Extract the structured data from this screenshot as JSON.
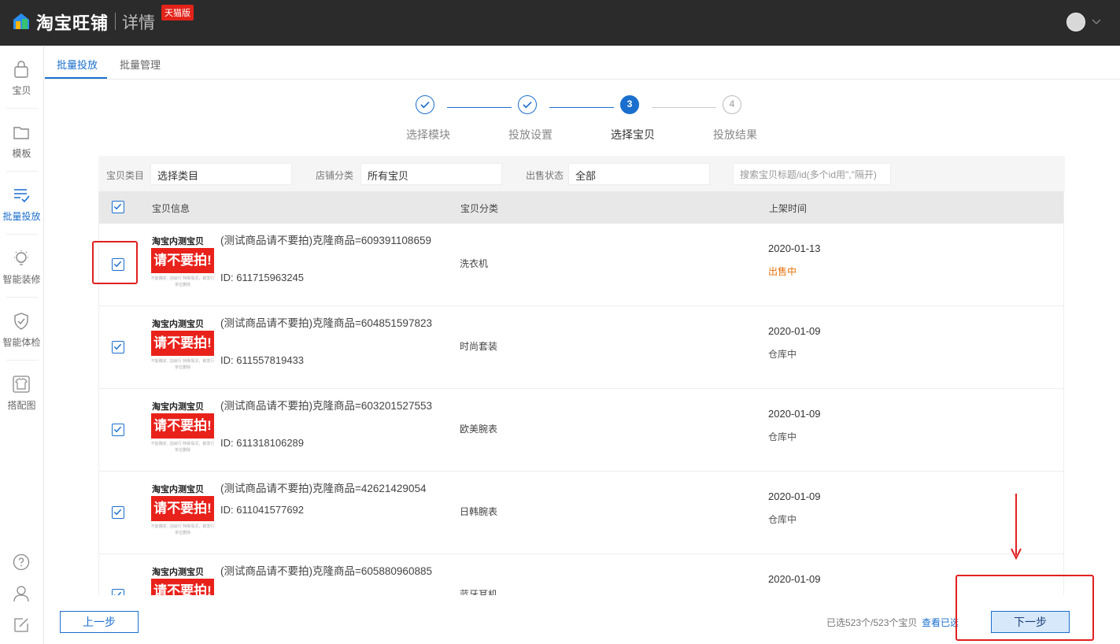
{
  "header": {
    "brand": "淘宝旺铺",
    "sub": "详情",
    "badge": "天猫版"
  },
  "sidebar": {
    "items": [
      {
        "label": "宝贝",
        "icon": "bag-icon"
      },
      {
        "label": "模板",
        "icon": "folder-icon"
      },
      {
        "label": "批量投放",
        "icon": "batch-list-icon"
      },
      {
        "label": "智能装修",
        "icon": "bulb-icon"
      },
      {
        "label": "智能体检",
        "icon": "shield-check-icon"
      },
      {
        "label": "搭配图",
        "icon": "shirt-icon"
      }
    ],
    "bottom_icons": [
      "help-icon",
      "user-icon",
      "edit-icon"
    ]
  },
  "tabs": [
    {
      "label": "批量投放",
      "active": true
    },
    {
      "label": "批量管理",
      "active": false
    }
  ],
  "steps": [
    {
      "num": "1",
      "label": "选择模块",
      "state": "done"
    },
    {
      "num": "2",
      "label": "投放设置",
      "state": "done"
    },
    {
      "num": "3",
      "label": "选择宝贝",
      "state": "current"
    },
    {
      "num": "4",
      "label": "投放结果",
      "state": "pending"
    }
  ],
  "filters": {
    "category_label": "宝贝类目",
    "category_value": "选择类目",
    "shop_label": "店铺分类",
    "shop_value": "所有宝贝",
    "status_label": "出售状态",
    "status_value": "全部",
    "search_placeholder": "搜索宝贝标题/id(多个id用\",\"隔开)"
  },
  "table": {
    "headers": {
      "info": "宝贝信息",
      "category": "宝贝分类",
      "time": "上架时间"
    },
    "thumb": {
      "line1": "淘宝内测宝贝",
      "line2": "请不要拍!",
      "line3": "不能确定...拍就行 特殊情况，被发行单位删除"
    },
    "rows": [
      {
        "title": "(测试商品请不要拍)克隆商品=609391108659",
        "id": "ID: 611715963245",
        "category": "洗衣机",
        "date": "2020-01-13",
        "status": "出售中"
      },
      {
        "title": "(测试商品请不要拍)克隆商品=604851597823",
        "id": "ID: 611557819433",
        "category": "时尚套装",
        "date": "2020-01-09",
        "status": "仓库中"
      },
      {
        "title": "(测试商品请不要拍)克隆商品=603201527553",
        "id": "ID: 611318106289",
        "category": "欧美腕表",
        "date": "2020-01-09",
        "status": "仓库中"
      },
      {
        "title": "(测试商品请不要拍)克隆商品=42621429054",
        "id": "ID: 611041577692",
        "category": "日韩腕表",
        "date": "2020-01-09",
        "status": "仓库中"
      },
      {
        "title": "(测试商品请不要拍)克隆商品=605880960885",
        "id": "",
        "category": "蓝牙耳机",
        "date": "2020-01-09",
        "status": ""
      }
    ]
  },
  "footer": {
    "prev": "上一步",
    "next": "下一步",
    "selected": "已选523个/523个宝贝",
    "view_selected": "查看已选"
  },
  "colors": {
    "accent": "#1a6fce",
    "sale": "#e8720c",
    "highlight": "#e02020"
  }
}
